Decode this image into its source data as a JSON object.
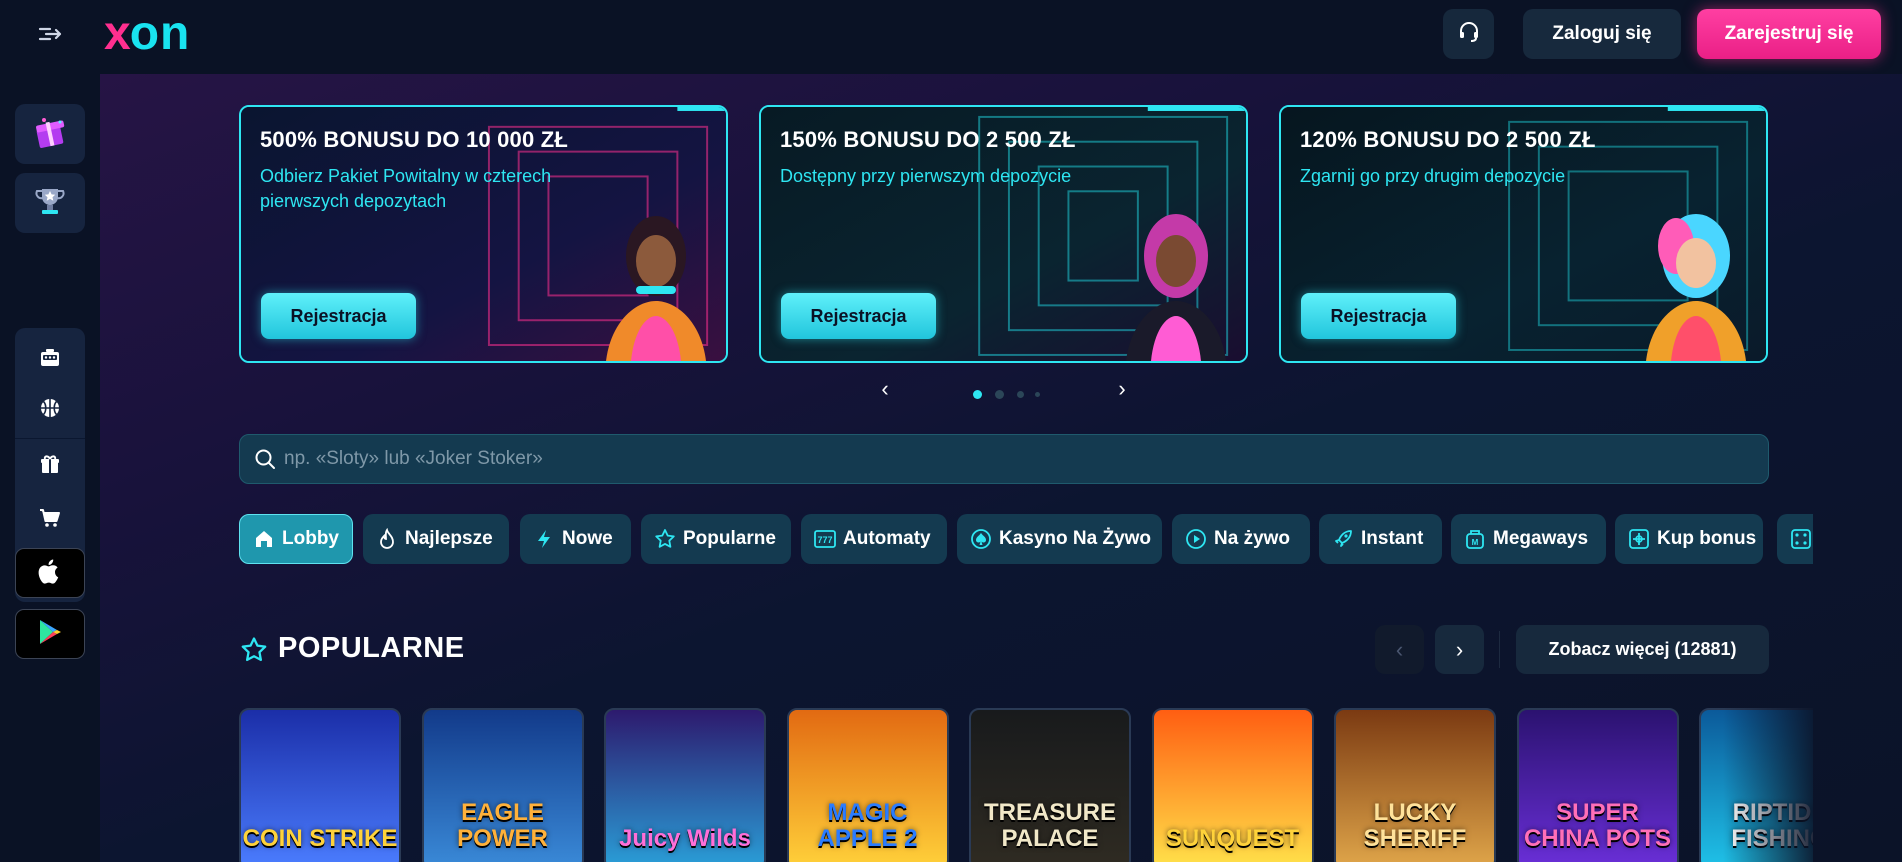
{
  "header": {
    "menu_icon": "sidebar-expand-icon",
    "logo_x": "x",
    "logo_on": "on",
    "support_icon": "headset-icon",
    "login_label": "Zaloguj się",
    "register_label": "Zarejestruj się"
  },
  "sidebar": {
    "promos": [
      {
        "icon": "gift-box-icon"
      },
      {
        "icon": "trophy-icon"
      }
    ],
    "nav": [
      {
        "icon": "casino-icon"
      },
      {
        "icon": "sports-ball-icon"
      },
      {
        "icon": "gift-icon"
      },
      {
        "icon": "cart-icon"
      },
      {
        "icon": "podium-icon"
      }
    ],
    "stores": [
      {
        "icon": "apple-icon"
      },
      {
        "icon": "google-play-icon"
      }
    ]
  },
  "banners": [
    {
      "title": "500% BONUSU DO 10 000 ZŁ",
      "subtitle": "Odbierz Pakiet Powitalny w czterech pierwszych depozytach",
      "button": "Rejestracja"
    },
    {
      "title": "150% BONUSU DO 2 500 ZŁ",
      "subtitle": "Dostępny przy pierwszym depozycie",
      "button": "Rejestracja"
    },
    {
      "title": "120% BONUSU DO 2 500 ZŁ",
      "subtitle": "Zgarnij go przy drugim depozycie",
      "button": "Rejestracja"
    }
  ],
  "carousel": {
    "prev_icon": "chevron-left-icon",
    "next_icon": "chevron-right-icon",
    "prev_glyph": "‹",
    "next_glyph": "›",
    "dot_count": 4,
    "active_dot": 0
  },
  "search": {
    "placeholder": "np. «Sloty» lub «Joker Stoker»",
    "value": ""
  },
  "categories": [
    {
      "label": "Lobby",
      "icon": "home-icon",
      "active": true
    },
    {
      "label": "Najlepsze",
      "icon": "flame-icon"
    },
    {
      "label": "Nowe",
      "icon": "lightning-icon"
    },
    {
      "label": "Popularne",
      "icon": "star-icon"
    },
    {
      "label": "Automaty",
      "icon": "slot-777-icon"
    },
    {
      "label": "Kasyno Na Żywo",
      "icon": "spade-chip-icon"
    },
    {
      "label": "Na żywo",
      "icon": "play-circle-icon"
    },
    {
      "label": "Instant",
      "icon": "rocket-icon"
    },
    {
      "label": "Megaways",
      "icon": "megaways-icon"
    },
    {
      "label": "Kup bonus",
      "icon": "buy-bonus-icon"
    },
    {
      "label": "",
      "icon": "dice-icon"
    }
  ],
  "popular": {
    "title": "POPULARNE",
    "see_more": "Zobacz więcej (12881)",
    "prev_glyph": "‹",
    "next_glyph": "›",
    "games": [
      {
        "name": "COIN STRIKE",
        "colors": [
          "#1b2ea8",
          "#4b7dff"
        ],
        "text_color": "#ffd23a"
      },
      {
        "name": "EAGLE POWER",
        "colors": [
          "#123a8a",
          "#3a8ad8"
        ],
        "text_color": "#ffb13a"
      },
      {
        "name": "Juicy Wilds",
        "colors": [
          "#2d1a6e",
          "#2a9fd8"
        ],
        "text_color": "#ff6fd8"
      },
      {
        "name": "MAGIC APPLE 2",
        "colors": [
          "#e26a12",
          "#ffd13a"
        ],
        "text_color": "#2a7cff"
      },
      {
        "name": "TREASURE PALACE",
        "colors": [
          "#181a1c",
          "#2f2b22"
        ],
        "text_color": "#f1e8c8"
      },
      {
        "name": "SUNQUEST",
        "colors": [
          "#ff5e12",
          "#ffe24a"
        ],
        "text_color": "#ffd23a"
      },
      {
        "name": "LUCKY SHERIFF",
        "colors": [
          "#7b3a12",
          "#e0a64a"
        ],
        "text_color": "#ffe29a"
      },
      {
        "name": "SUPER CHINA POTS",
        "colors": [
          "#2b1270",
          "#6a2fd8"
        ],
        "text_color": "#ff6fb8"
      },
      {
        "name": "RIPTIDE FISHING",
        "colors": [
          "#0b5a9a",
          "#1fc2e8"
        ],
        "text_color": "#ffffff"
      }
    ]
  },
  "colors": {
    "accent_cyan": "#2ee6f2",
    "accent_pink": "#ff2f8f",
    "panel": "#143a50"
  }
}
